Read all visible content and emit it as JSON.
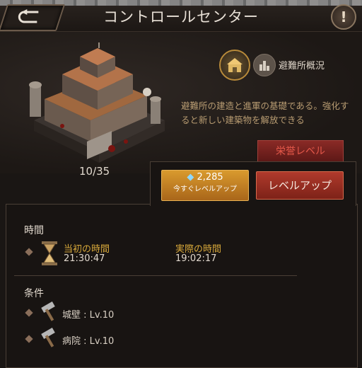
{
  "header": {
    "title": "コントロールセンター",
    "back_icon": "back-arrow-icon",
    "info_label": "!"
  },
  "building": {
    "level_count": "10/35",
    "overview_label": "避難所概況",
    "description": "避難所の建造と進軍の基礎である。強化すると新しい建築物を解放できる",
    "glory_tab_label": "栄誉レベル"
  },
  "actions": {
    "gem_cost": "2,285",
    "instant_label": "今すぐレベルアップ",
    "levelup_label": "レベルアップ"
  },
  "time": {
    "section_title": "時間",
    "original_label": "当初の時間",
    "original_value": "21:30:47",
    "actual_label": "実際の時間",
    "actual_value": "19:02:17"
  },
  "requirements": {
    "section_title": "条件",
    "items": [
      {
        "text": "城壁 : Lv.10"
      },
      {
        "text": "病院 : Lv.10"
      }
    ]
  },
  "colors": {
    "accent_gold": "#d7a83a",
    "button_red": "#b03a2c",
    "button_orange": "#d99a2e"
  }
}
